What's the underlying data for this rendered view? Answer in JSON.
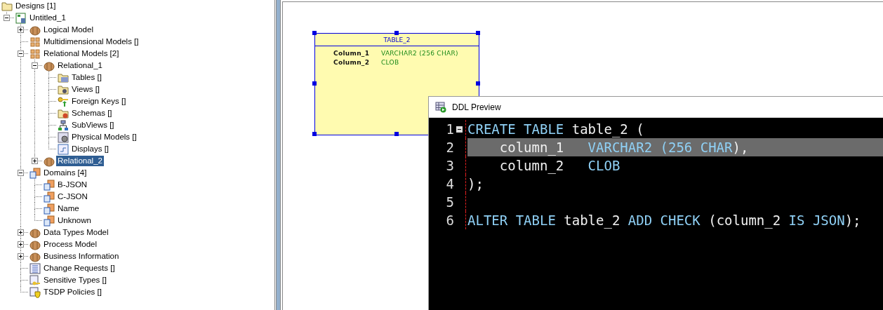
{
  "navigator": {
    "root": {
      "label": "Designs [1]",
      "kind": "folder"
    },
    "tree": [
      {
        "label": "Untitled_1",
        "kind": "design",
        "expanded": true,
        "selected": false,
        "children": [
          {
            "label": "Logical Model",
            "kind": "cube",
            "expanded": false,
            "selected": false
          },
          {
            "label": "Multidimensional Models []",
            "kind": "grid",
            "selected": false
          },
          {
            "label": "Relational Models [2]",
            "kind": "grid",
            "expanded": true,
            "selected": false,
            "children": [
              {
                "label": "Relational_1",
                "kind": "cube",
                "expanded": true,
                "selected": false,
                "children": [
                  {
                    "label": "Tables []",
                    "kind": "tables",
                    "selected": false
                  },
                  {
                    "label": "Views []",
                    "kind": "views",
                    "selected": false
                  },
                  {
                    "label": "Foreign Keys []",
                    "kind": "key",
                    "selected": false
                  },
                  {
                    "label": "Schemas []",
                    "kind": "schemas",
                    "selected": false
                  },
                  {
                    "label": "SubViews []",
                    "kind": "subviews",
                    "selected": false
                  },
                  {
                    "label": "Physical Models []",
                    "kind": "physical",
                    "selected": false
                  },
                  {
                    "label": "Displays []",
                    "kind": "displays",
                    "selected": false
                  }
                ]
              },
              {
                "label": "Relational_2",
                "kind": "cube",
                "expanded": false,
                "selected": true
              }
            ]
          },
          {
            "label": "Domains [4]",
            "kind": "domain",
            "expanded": true,
            "selected": false,
            "children": [
              {
                "label": "B-JSON",
                "kind": "domain",
                "selected": false
              },
              {
                "label": "C-JSON",
                "kind": "domain",
                "selected": false
              },
              {
                "label": "Name",
                "kind": "domain",
                "selected": false
              },
              {
                "label": "Unknown",
                "kind": "domain",
                "selected": false
              }
            ]
          },
          {
            "label": "Data Types Model",
            "kind": "cube",
            "expanded": false,
            "selected": false
          },
          {
            "label": "Process Model",
            "kind": "cube",
            "expanded": false,
            "selected": false
          },
          {
            "label": "Business Information",
            "kind": "cube",
            "expanded": false,
            "selected": false
          },
          {
            "label": "Change Requests []",
            "kind": "list",
            "selected": false
          },
          {
            "label": "Sensitive Types []",
            "kind": "sensitive",
            "selected": false
          },
          {
            "label": "TSDP Policies []",
            "kind": "policy",
            "selected": false
          }
        ]
      }
    ]
  },
  "diagram": {
    "table": {
      "title": "TABLE_2",
      "selected": true,
      "columns": [
        {
          "name": "Column_1",
          "type": "VARCHAR2 (256 CHAR)"
        },
        {
          "name": "Column_2",
          "type": "CLOB"
        }
      ]
    }
  },
  "ddl_preview": {
    "title": "DDL Preview",
    "lines": [
      {
        "number": "1",
        "fold": true,
        "highlighted": false,
        "tokens": [
          {
            "text": "CREATE TABLE",
            "kind": "keyword"
          },
          {
            "text": " table_2 (",
            "kind": "plain"
          }
        ]
      },
      {
        "number": "2",
        "fold": false,
        "highlighted": true,
        "tokens": [
          {
            "text": "    column_1   ",
            "kind": "plain"
          },
          {
            "text": "VARCHAR2 (256 CHAR",
            "kind": "keyword"
          },
          {
            "text": "),",
            "kind": "plain"
          }
        ]
      },
      {
        "number": "3",
        "fold": false,
        "highlighted": false,
        "tokens": [
          {
            "text": "    column_2   ",
            "kind": "plain"
          },
          {
            "text": "CLOB",
            "kind": "keyword"
          }
        ]
      },
      {
        "number": "4",
        "fold": false,
        "highlighted": false,
        "tokens": [
          {
            "text": ");",
            "kind": "plain"
          }
        ]
      },
      {
        "number": "5",
        "fold": false,
        "highlighted": false
      },
      {
        "number": "6",
        "fold": false,
        "highlighted": false,
        "tokens": [
          {
            "text": "ALTER TABLE",
            "kind": "keyword"
          },
          {
            "text": " table_2 ",
            "kind": "plain"
          },
          {
            "text": "ADD CHECK",
            "kind": "keyword"
          },
          {
            "text": " (column_2 ",
            "kind": "plain"
          },
          {
            "text": "IS JSON",
            "kind": "keyword"
          },
          {
            "text": ");",
            "kind": "plain"
          }
        ]
      }
    ]
  }
}
